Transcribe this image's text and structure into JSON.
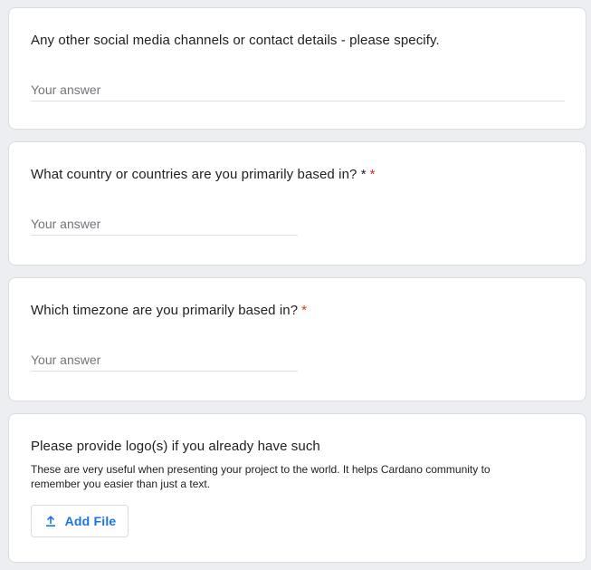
{
  "questions": [
    {
      "text": "Any other social media channels or contact details - please specify.",
      "placeholder": "Your answer",
      "required": false
    },
    {
      "text": "What country or countries are you primarily based in? *",
      "placeholder": "Your answer",
      "required": true,
      "required_mark": "*"
    },
    {
      "text": "Which timezone are you primarily based in?",
      "placeholder": "Your answer",
      "required": true,
      "required_mark": "*"
    },
    {
      "text": "Please provide logo(s) if you already have such",
      "description": "These are very useful when presenting your project to the world. It helps Cardano community to remember you easier than just a text.",
      "button_label": "Add File",
      "button_icon": "upload-icon"
    }
  ],
  "colors": {
    "accent": "#1a73e8",
    "required": "#d93025",
    "background": "#eceef1"
  }
}
